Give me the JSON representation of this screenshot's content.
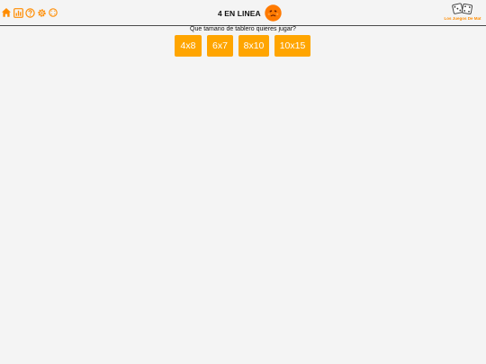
{
  "header": {
    "title": "4 EN LINEA",
    "icons": [
      "home-icon",
      "stats-icon",
      "help-icon",
      "settings-icon",
      "fullscreen-icon"
    ],
    "brand": "Los Juegos De Mat"
  },
  "main": {
    "prompt": "Que tamano de tablero quieres jugar?",
    "board_sizes": [
      {
        "label": "4x8"
      },
      {
        "label": "6x7"
      },
      {
        "label": "8x10"
      },
      {
        "label": "10x15"
      }
    ]
  },
  "colors": {
    "accent": "#ffa500",
    "icon": "#ff8c00",
    "background": "#f4f4f4"
  }
}
